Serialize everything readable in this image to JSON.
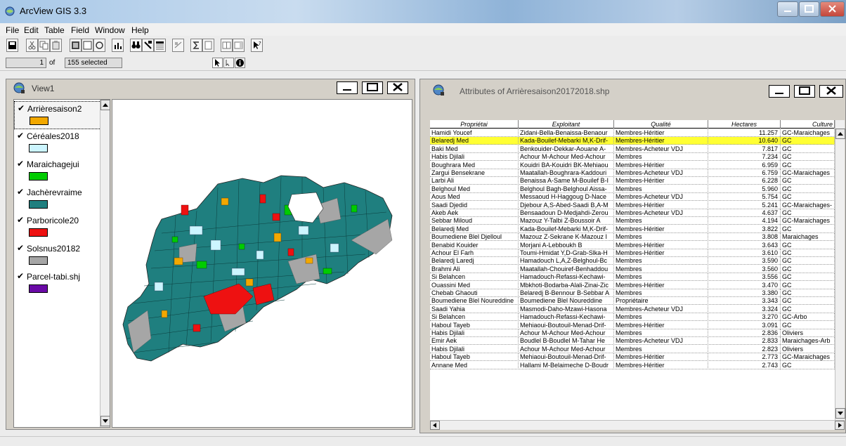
{
  "window": {
    "title": "ArcView GIS 3.3"
  },
  "menu": [
    "File",
    "Edit",
    "Table",
    "Field",
    "Window",
    "Help"
  ],
  "status": {
    "record_index": "1",
    "of_label": "of",
    "selected_text": "155 selected"
  },
  "view": {
    "title": "View1",
    "layers": [
      {
        "label": "Arrièresaison2",
        "color": "#f2a800"
      },
      {
        "label": "Céréales2018",
        "color": "#ccf5ff"
      },
      {
        "label": "Maraichagejui",
        "color": "#00cc00"
      },
      {
        "label": "Jachèrevraime",
        "color": "#1f7f7f"
      },
      {
        "label": "Parboricole20",
        "color": "#ee1111"
      },
      {
        "label": "Solsnus20182",
        "color": "#a6a6a6"
      },
      {
        "label": "Parcel-tabi.shj",
        "color": "#6a0aa6"
      }
    ]
  },
  "attributes": {
    "title": "Attributes of Arrièresaison20172018.shp",
    "columns": [
      "Propriétai",
      "Exploitant",
      "Qualité",
      "Hectares",
      "Culture"
    ],
    "rows": [
      [
        "Hamidi Youcef",
        "Zidani-Bella-Benaissa-Benaour",
        "Membres-Héritier",
        "11.257",
        "GC-Maraichages"
      ],
      [
        "Belaredj Med",
        "Kada-Bouilef-Mebarki M,K-Drif-",
        "Membres-Héritier",
        "10.640",
        "GC"
      ],
      [
        "Baki Med",
        "Benkouider-Dekkar-Aouane A-",
        "Membres-Acheteur VDJ",
        "7.817",
        "GC"
      ],
      [
        "Habis Djilali",
        "Achour M-Achour Med-Achour",
        "Membres",
        "7.234",
        "GC"
      ],
      [
        "Boughrara Med",
        "Kouidri BA-Kouidri BK-Mehiaou",
        "Membres-Héritier",
        "6.959",
        "GC"
      ],
      [
        "Zargui Bensekrane",
        "Maatallah-Boughrara-Kaddouri",
        "Membres-Acheteur VDJ",
        "6.759",
        "GC-Maraichages"
      ],
      [
        "Larbi Ali",
        "Benaissa A-Same M-Bouilef B-I",
        "Membres-Héritier",
        "6.228",
        "GC"
      ],
      [
        "Belghoul Med",
        "Belghoul Bagh-Belghoul Aissa-",
        "Membres",
        "5.960",
        "GC"
      ],
      [
        "Aous Med",
        "Messaoud H-Haggoug D-Nace",
        "Membres-Acheteur VDJ",
        "5.754",
        "GC"
      ],
      [
        "Saadi Djedid",
        "Djebour A,S-Abed-Saadi B,A-M",
        "Membres-Héritier",
        "5.241",
        "GC-Maraichages-"
      ],
      [
        "Akeb Aek",
        "Bensaadoun D-Medjahdi-Zerou",
        "Membres-Acheteur VDJ",
        "4.637",
        "GC"
      ],
      [
        "Sebbar Miloud",
        "Mazouz Y-Talbi Z-Boussoir A",
        "Membres",
        "4.194",
        "GC-Maraichages"
      ],
      [
        "Belaredj Med",
        "Kada-Bouilef-Mebarki M,K-Drif-",
        "Membres-Héritier",
        "3.822",
        "GC"
      ],
      [
        "Boumediene Blel Djelloul",
        "Mazouz Z-Sekrane K-Mazouz I",
        "Membres",
        "3.808",
        "Maraichages"
      ],
      [
        "Benabid Kouider",
        "Morjani A-Lebboukh B",
        "Membres-Héritier",
        "3.643",
        "GC"
      ],
      [
        "Achour El Farh",
        "Toumi-Hmidat Y,D-Grab-Slka-H",
        "Membres-Héritier",
        "3.610",
        "GC"
      ],
      [
        "Belaredj Laredj",
        "Hamadouch L,A,Z-Belghoul-Bc",
        "Membres",
        "3.590",
        "GC"
      ],
      [
        "Brahmi Ali",
        "Maatallah-Chouiref-Benhaddou",
        "Membres",
        "3.560",
        "GC"
      ],
      [
        "Si Belahcen",
        "Hamadouch-Refassi-Kechawi-",
        "Membres",
        "3.556",
        "GC"
      ],
      [
        "Ouassini Med",
        "Mbkhoti-Bodarba-Alali-Zinai-Zic",
        "Membres-Héritier",
        "3.470",
        "GC"
      ],
      [
        "Chebab Ghaouti",
        "Belaredj B-Bennour B-Sebbar A",
        "Membres",
        "3.380",
        "GC"
      ],
      [
        "Boumediene Blel Noureddine",
        "Boumediene Blel Noureddine",
        "Propriétaire",
        "3.343",
        "GC"
      ],
      [
        "Saadi Yahia",
        "Masmodi-Daho-Mzawi-Hasona",
        "Membres-Acheteur VDJ",
        "3.324",
        "GC"
      ],
      [
        "Si Belahcen",
        "Hamadouch-Refassi-Kechawi-",
        "Membres",
        "3.270",
        "GC-Arbo"
      ],
      [
        "Haboul Tayeb",
        "Mehiaoui-Boutouil-Menad-Drif-",
        "Membres-Héritier",
        "3.091",
        "GC"
      ],
      [
        "Habis Djilali",
        "Achour M-Achour Med-Achour",
        "Membres",
        "2.836",
        "Oliviers"
      ],
      [
        "Emir Aek",
        "Boudlel B-Boudlel M-Tahar He",
        "Membres-Acheteur VDJ",
        "2.833",
        "Maraichages-Arb"
      ],
      [
        "Habis Djilali",
        "Achour M-Achour Med-Achour",
        "Membres",
        "2.823",
        "Oliviers"
      ],
      [
        "Haboul Tayeb",
        "Mehiaoui-Boutouil-Menad-Drif-",
        "Membres-Héritier",
        "2.773",
        "GC-Maraichages"
      ],
      [
        "Annane Med",
        "Hallami M-Belaimeche D-Boudr",
        "Membres-Héritier",
        "2.743",
        "GC"
      ]
    ],
    "selected_row": 1,
    "selection_color": "#ffff33"
  }
}
